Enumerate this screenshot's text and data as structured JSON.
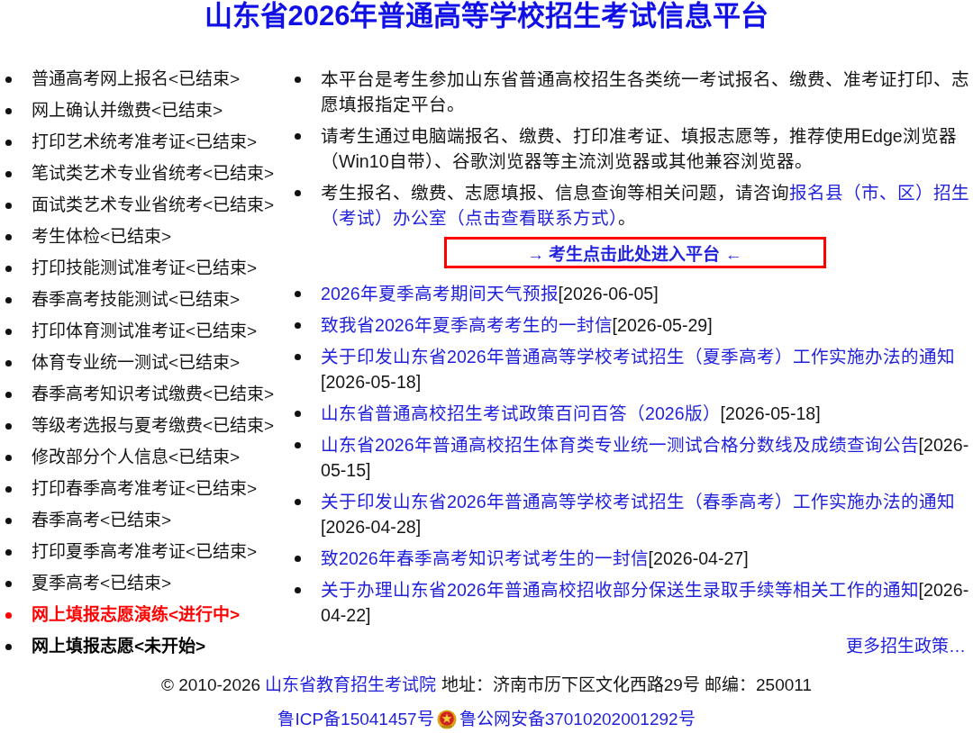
{
  "title": "山东省2026年普通高等学校招生考试信息平台",
  "sidebar": {
    "items": [
      {
        "label": "普通高考网上报名<已结束>",
        "kind": "ended"
      },
      {
        "label": "网上确认并缴费<已结束>",
        "kind": "ended"
      },
      {
        "label": "打印艺术统考准考证<已结束>",
        "kind": "ended"
      },
      {
        "label": "笔试类艺术专业省统考<已结束>",
        "kind": "ended"
      },
      {
        "label": "面试类艺术专业省统考<已结束>",
        "kind": "ended"
      },
      {
        "label": "考生体检<已结束>",
        "kind": "ended"
      },
      {
        "label": "打印技能测试准考证<已结束>",
        "kind": "ended"
      },
      {
        "label": "春季高考技能测试<已结束>",
        "kind": "ended"
      },
      {
        "label": "打印体育测试准考证<已结束>",
        "kind": "ended"
      },
      {
        "label": "体育专业统一测试<已结束>",
        "kind": "ended"
      },
      {
        "label": "春季高考知识考试缴费<已结束>",
        "kind": "ended"
      },
      {
        "label": "等级考选报与夏考缴费<已结束>",
        "kind": "ended"
      },
      {
        "label": "修改部分个人信息<已结束>",
        "kind": "ended"
      },
      {
        "label": "打印春季高考准考证<已结束>",
        "kind": "ended"
      },
      {
        "label": "春季高考<已结束>",
        "kind": "ended"
      },
      {
        "label": "打印夏季高考准考证<已结束>",
        "kind": "ended"
      },
      {
        "label": "夏季高考<已结束>",
        "kind": "ended"
      },
      {
        "label": "网上填报志愿演练<进行中>",
        "kind": "active"
      },
      {
        "label": "网上填报志愿<未开始>",
        "kind": "pending"
      }
    ]
  },
  "notices": [
    {
      "parts": [
        {
          "kind": "text",
          "text": "本平台是考生参加山东省普通高校招生各类统一考试报名、缴费、准考证打印、志愿填报指定平台。"
        }
      ]
    },
    {
      "parts": [
        {
          "kind": "text",
          "text": "请考生通过电脑端报名、缴费、打印准考证、填报志愿等，推荐使用Edge浏览器（Win10自带）、谷歌浏览器等主流浏览器或其他兼容浏览器。"
        }
      ]
    },
    {
      "parts": [
        {
          "kind": "text",
          "text": "考生报名、缴费、志愿填报、信息查询等相关问题，请咨询"
        },
        {
          "kind": "link",
          "text": "报名县（市、区）招生"
        },
        {
          "kind": "link",
          "text": "（考试）办公室（点击查看联系方式）"
        },
        {
          "kind": "text",
          "text": "。"
        }
      ]
    }
  ],
  "entry_button": {
    "label": "→ 考生点击此处进入平台 ←"
  },
  "news": [
    {
      "title": "2026年夏季高考期间天气预报",
      "date": "[2026-06-05]"
    },
    {
      "title": "致我省2026年夏季高考考生的一封信",
      "date": "[2026-05-29]"
    },
    {
      "title": "关于印发山东省2026年普通高等学校考试招生（夏季高考）工作实施办法的通知",
      "date": "[2026-05-18]"
    },
    {
      "title": "山东省普通高校招生考试政策百问百答（2026版）",
      "date": "[2026-05-18]"
    },
    {
      "title": "山东省2026年普通高校招生体育类专业统一测试合格分数线及成绩查询公告",
      "date": "[2026-05-15]"
    },
    {
      "title": "关于印发山东省2026年普通高等学校考试招生（春季高考）工作实施办法的通知",
      "date": "[2026-04-28]"
    },
    {
      "title": "致2026年春季高考知识考试考生的一封信",
      "date": "[2026-04-27]"
    },
    {
      "title": "关于办理山东省2026年普通高校招收部分保送生录取手续等相关工作的通知",
      "date": "[2026-04-22]"
    }
  ],
  "more_link": "更多招生政策…",
  "footer": {
    "copyright": [
      {
        "kind": "text",
        "text": "© 2010-2026 "
      },
      {
        "kind": "link",
        "text": "山东省教育招生考试院"
      },
      {
        "kind": "text",
        "text": " 地址：济南市历下区文化西路29号 邮编：250011"
      }
    ],
    "icp": "鲁ICP备15041457号",
    "police_record": "鲁公网安备37010202001292号"
  }
}
